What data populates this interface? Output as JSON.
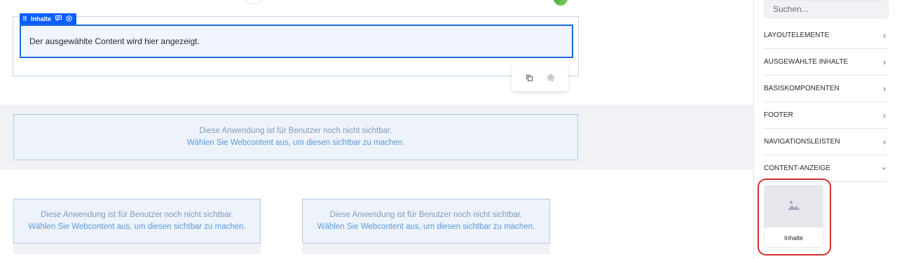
{
  "fragment": {
    "label": "Inhalte",
    "content_text": "Der ausgewählte Content wird hier angezeigt."
  },
  "notices": {
    "wide": {
      "line1": "Diese Anwendung ist für Benutzer noch nicht sichtbar.",
      "line2": "Wählen Sie Webcontent aus, um diesen sichtbar zu machen."
    },
    "left": {
      "line1": "Diese Anwendung ist für Benutzer noch nicht sichtbar.",
      "line2": "Wählen Sie Webcontent aus, um diesen sichtbar zu machen."
    },
    "right": {
      "line1": "Diese Anwendung ist für Benutzer noch nicht sichtbar.",
      "line2": "Wählen Sie Webcontent aus, um diesen sichtbar zu machen."
    }
  },
  "toolbar": {
    "duplicate_icon": "copy-icon",
    "settings_icon": "gear-icon"
  },
  "sidebar": {
    "search": {
      "placeholder": "Suchen...",
      "value": ""
    },
    "categories": [
      {
        "label": "LAYOUTELEMENTE",
        "expanded": false
      },
      {
        "label": "AUSGEWÄHLTE INHALTE",
        "expanded": false
      },
      {
        "label": "BASISKOMPONENTEN",
        "expanded": false
      },
      {
        "label": "FOOTER",
        "expanded": false
      },
      {
        "label": "NAVIGATIONSLEISTEN",
        "expanded": false
      },
      {
        "label": "CONTENT-ANZEIGE",
        "expanded": true
      }
    ],
    "card": {
      "label": "Inhalte",
      "icon": "image-icon"
    }
  },
  "colors": {
    "accent": "#0b5fff",
    "selection_border": "#1e6ad6",
    "highlight": "#d32f2f"
  }
}
